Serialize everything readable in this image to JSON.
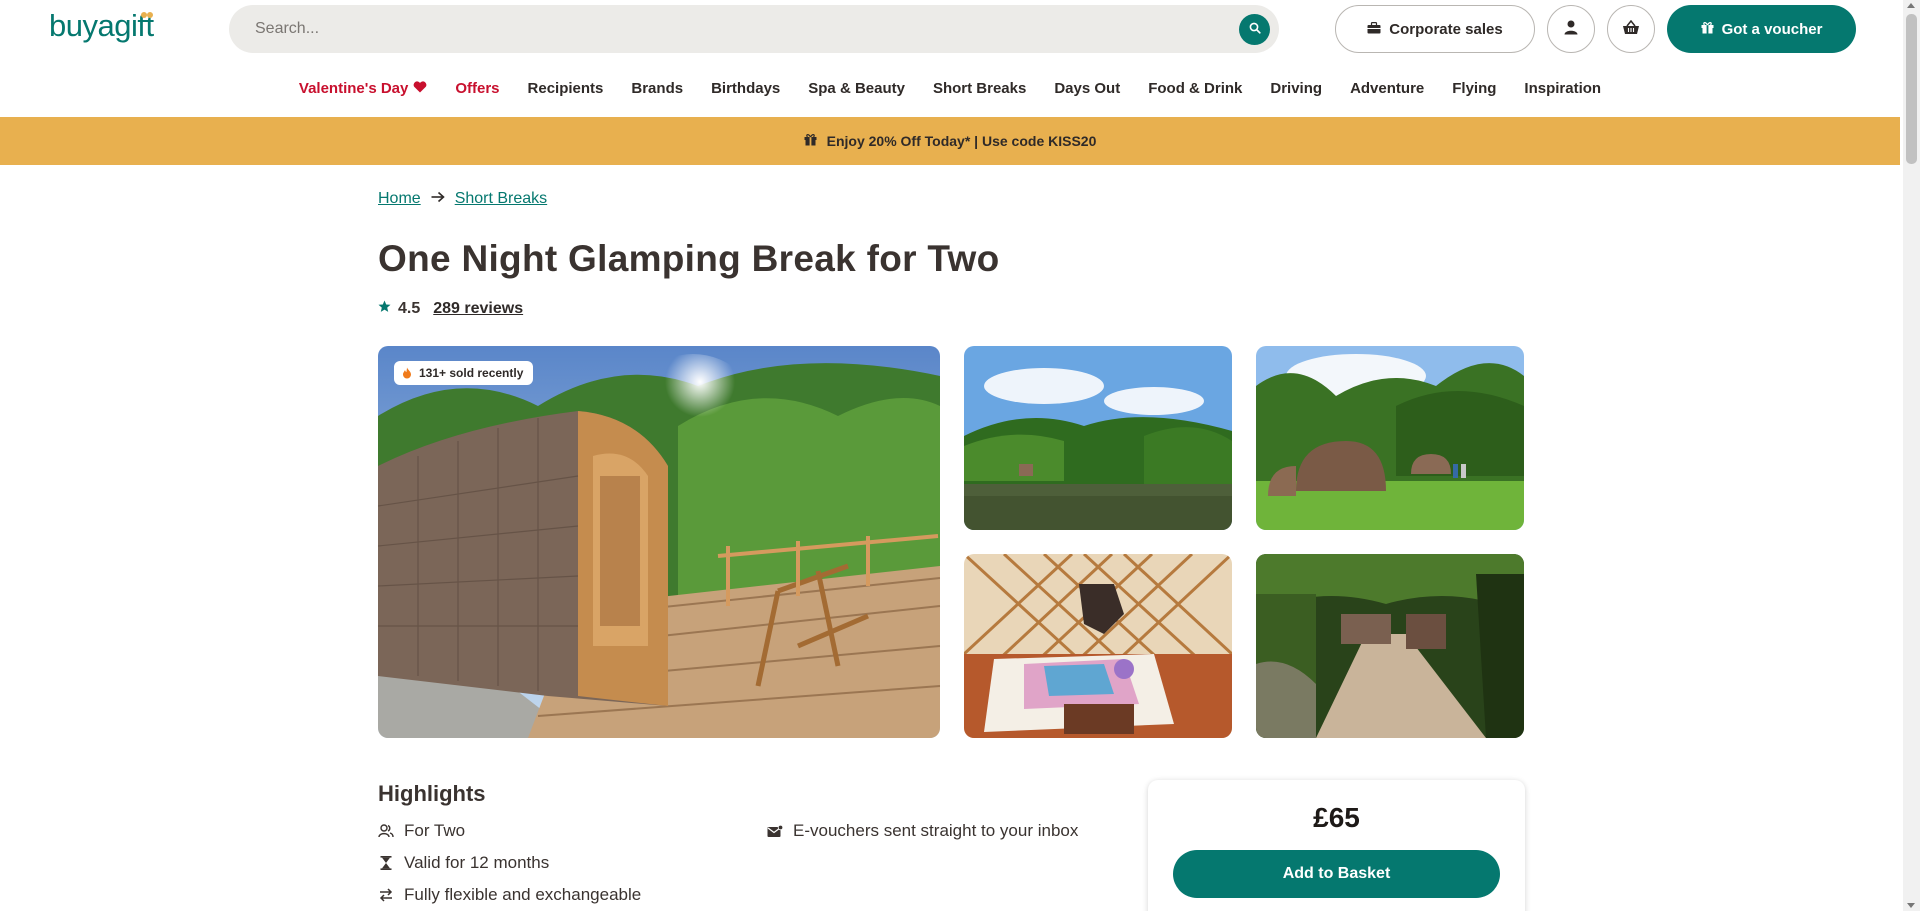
{
  "brand": {
    "logo_text": "buyagift",
    "accent": "#05786f",
    "promo_bg": "#e8b04f",
    "sale_red": "#c8102e"
  },
  "header": {
    "search_placeholder": "Search...",
    "corporate_label": "Corporate sales",
    "voucher_label": "Got a voucher",
    "icons": [
      "search-icon",
      "briefcase-icon",
      "user-icon",
      "basket-icon",
      "gift-icon"
    ]
  },
  "nav": {
    "items": [
      {
        "label": "Valentine's Day",
        "highlight": true,
        "icon": "heart-icon"
      },
      {
        "label": "Offers",
        "highlight": true
      },
      {
        "label": "Recipients"
      },
      {
        "label": "Brands"
      },
      {
        "label": "Birthdays"
      },
      {
        "label": "Spa & Beauty"
      },
      {
        "label": "Short Breaks"
      },
      {
        "label": "Days Out"
      },
      {
        "label": "Food & Drink"
      },
      {
        "label": "Driving"
      },
      {
        "label": "Adventure"
      },
      {
        "label": "Flying"
      },
      {
        "label": "Inspiration"
      }
    ]
  },
  "promo": {
    "text": "Enjoy 20% Off Today* | Use code KISS20",
    "icon": "gift-icon"
  },
  "breadcrumb": {
    "items": [
      "Home",
      "Short Breaks"
    ]
  },
  "product": {
    "title": "One Night Glamping Break for Two",
    "rating": "4.5",
    "reviews": "289 reviews",
    "sold_badge": "131+ sold recently",
    "price": "£65",
    "add_to_basket": "Add to Basket"
  },
  "highlights": {
    "title": "Highlights",
    "items": [
      {
        "label": "For Two",
        "icon": "people-icon"
      },
      {
        "label": "Valid for 12 months",
        "icon": "hourglass-icon"
      },
      {
        "label": "Fully flexible and exchangeable",
        "icon": "exchange-icon"
      },
      {
        "label": "E-vouchers sent straight to your inbox",
        "icon": "envelope-icon"
      }
    ]
  }
}
